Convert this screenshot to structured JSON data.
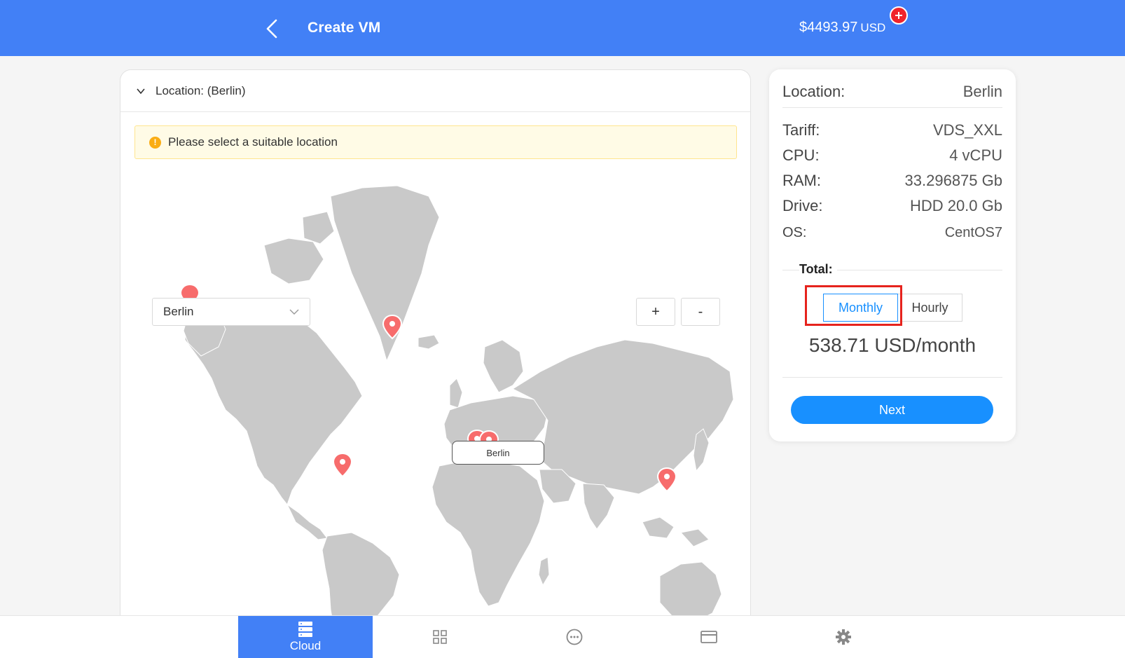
{
  "header": {
    "title": "Create VM",
    "balance_amount": "$4493.97",
    "balance_currency": "USD",
    "back_icon": "chevron-left-icon",
    "topup_icon": "plus-circle-icon",
    "color": "#4280f6"
  },
  "location_panel": {
    "header_label": "Location: (Berlin)",
    "alert_text": "Please select a suitable location",
    "select_value": "Berlin",
    "zoom_in_label": "+",
    "zoom_out_label": "-",
    "tooltip": "Berlin",
    "highlighted_country_color": "#6a56a8",
    "marker_color": "#f76c6c",
    "land_color": "#c9c9c9"
  },
  "summary": {
    "location_label": "Location:",
    "location_value": "Berlin",
    "rows": [
      {
        "label": "Tariff:",
        "value": "VDS_XXL"
      },
      {
        "label": "CPU:",
        "value": "4 vCPU"
      },
      {
        "label": "RAM:",
        "value": "33.296875 Gb"
      },
      {
        "label": "Drive:",
        "value": "HDD 20.0 Gb"
      },
      {
        "label": "OS:",
        "value": "CentOS7"
      }
    ],
    "total_label": "Total:",
    "period_options": [
      "Monthly",
      "Hourly"
    ],
    "selected_period": "Monthly",
    "price": "538.71 USD/month",
    "next_label": "Next"
  },
  "bottom_nav": {
    "items": [
      {
        "label": "Cloud",
        "icon": "server-icon",
        "active": true
      },
      {
        "label": "",
        "icon": "grid-icon",
        "active": false
      },
      {
        "label": "",
        "icon": "chat-icon",
        "active": false
      },
      {
        "label": "",
        "icon": "card-icon",
        "active": false
      },
      {
        "label": "",
        "icon": "gear-icon",
        "active": false
      }
    ]
  }
}
